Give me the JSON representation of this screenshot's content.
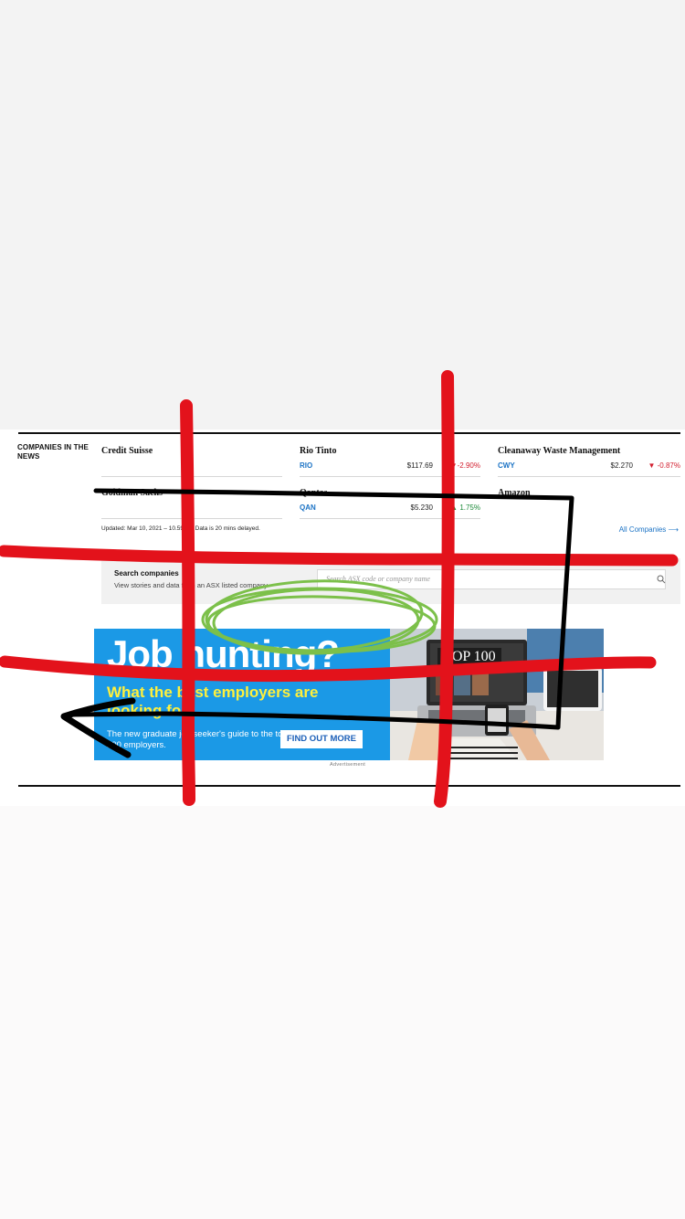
{
  "section": {
    "title": "COMPANIES IN THE NEWS"
  },
  "companies": [
    {
      "name": "Credit Suisse",
      "code": "",
      "price": "",
      "change": "",
      "direction": ""
    },
    {
      "name": "Rio Tinto",
      "code": "RIO",
      "price": "$117.69",
      "change": "-2.90%",
      "direction": "down"
    },
    {
      "name": "Cleanaway Waste Management",
      "code": "CWY",
      "price": "$2.270",
      "change": "-0.87%",
      "direction": "down"
    },
    {
      "name": "Goldman Sachs",
      "code": "",
      "price": "",
      "change": "",
      "direction": ""
    },
    {
      "name": "Qantas",
      "code": "QAN",
      "price": "$5.230",
      "change": "1.75%",
      "direction": "up"
    },
    {
      "name": "Amazon",
      "code": "",
      "price": "",
      "change": "",
      "direction": ""
    }
  ],
  "updated_text": "Updated: Mar 10, 2021 – 10.59am. Data is 20 mins delayed.",
  "all_companies_link": "All Companies",
  "search": {
    "title": "Search companies",
    "subtitle": "View stories and data from an ASX listed company",
    "placeholder": "Search ASX code or company name"
  },
  "ad": {
    "headline": "Job hunting?",
    "subhead": "What the best employers are looking for.",
    "body": "The new graduate job seeker's guide to the top 100 employers.",
    "cta": "FIND OUT MORE",
    "magazine_title": "TOP 100",
    "label": "Advertisement"
  },
  "colors": {
    "link": "#1b73c5",
    "negative": "#d21f2f",
    "positive": "#1d8a3a",
    "ad_background": "#1b99e6",
    "ad_highlight": "#fff03c",
    "annotation_red": "#e3121b",
    "annotation_green": "#7cc04a",
    "annotation_black": "#000000"
  },
  "icons": [
    "search-icon",
    "arrow-right-icon",
    "triangle-down-icon",
    "triangle-up-icon"
  ]
}
